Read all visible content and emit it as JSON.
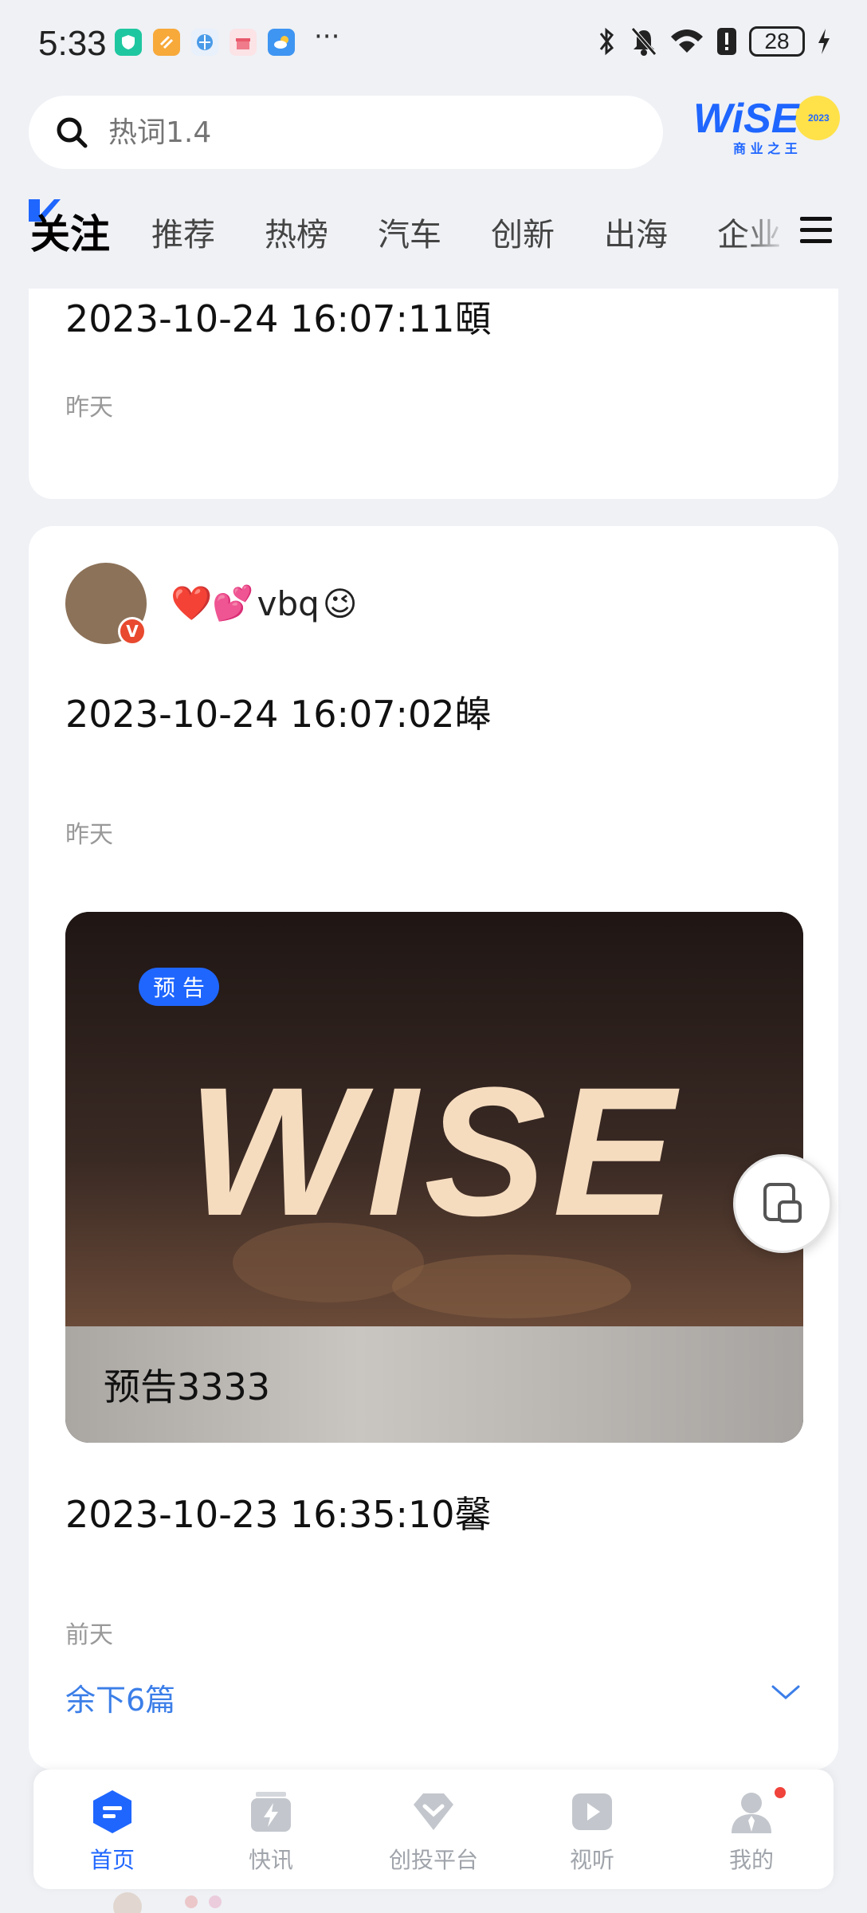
{
  "status_bar": {
    "time": "5:33",
    "more": "···",
    "battery": "28",
    "app_icons": [
      "shield-app-icon",
      "orange-app-icon",
      "browser-app-icon",
      "gift-app-icon",
      "cloud-app-icon"
    ],
    "system_icons": [
      "bluetooth-icon",
      "mute-icon",
      "wifi-icon",
      "alert-icon",
      "charging-icon"
    ]
  },
  "header": {
    "search_placeholder": "热词1.4",
    "logo_text": "WiSE",
    "logo_year": "2023",
    "logo_subtitle": "商 业 之 王"
  },
  "tabs": [
    {
      "label": "关注",
      "active": true
    },
    {
      "label": "推荐"
    },
    {
      "label": "热榜"
    },
    {
      "label": "汽车"
    },
    {
      "label": "创新"
    },
    {
      "label": "出海"
    },
    {
      "label": "企业"
    }
  ],
  "feed": {
    "card1": {
      "text": "2023-10-24 16:07:11頤",
      "time": "昨天"
    },
    "card2": {
      "username_emojis": "❤️💕",
      "username_text": "vbq",
      "username_emoji_end": "😉",
      "verified": "V",
      "text": "2023-10-24 16:07:02皞",
      "time": "昨天",
      "media": {
        "tag": "预 告",
        "caption": "预告3333",
        "image_text": "WISE"
      },
      "text2": "2023-10-23 16:35:10馨",
      "time2": "前天",
      "remaining": "余下6篇"
    }
  },
  "bottom_nav": [
    {
      "label": "首页",
      "icon": "home-icon",
      "active": true
    },
    {
      "label": "快讯",
      "icon": "flash-news-icon"
    },
    {
      "label": "创投平台",
      "icon": "venture-platform-icon"
    },
    {
      "label": "视听",
      "icon": "video-play-icon"
    },
    {
      "label": "我的",
      "icon": "profile-icon",
      "badge": true
    }
  ],
  "colors": {
    "accent": "#1f66ff",
    "link": "#3b7ee8",
    "background": "#eff1f5",
    "badge": "#f0433b"
  }
}
